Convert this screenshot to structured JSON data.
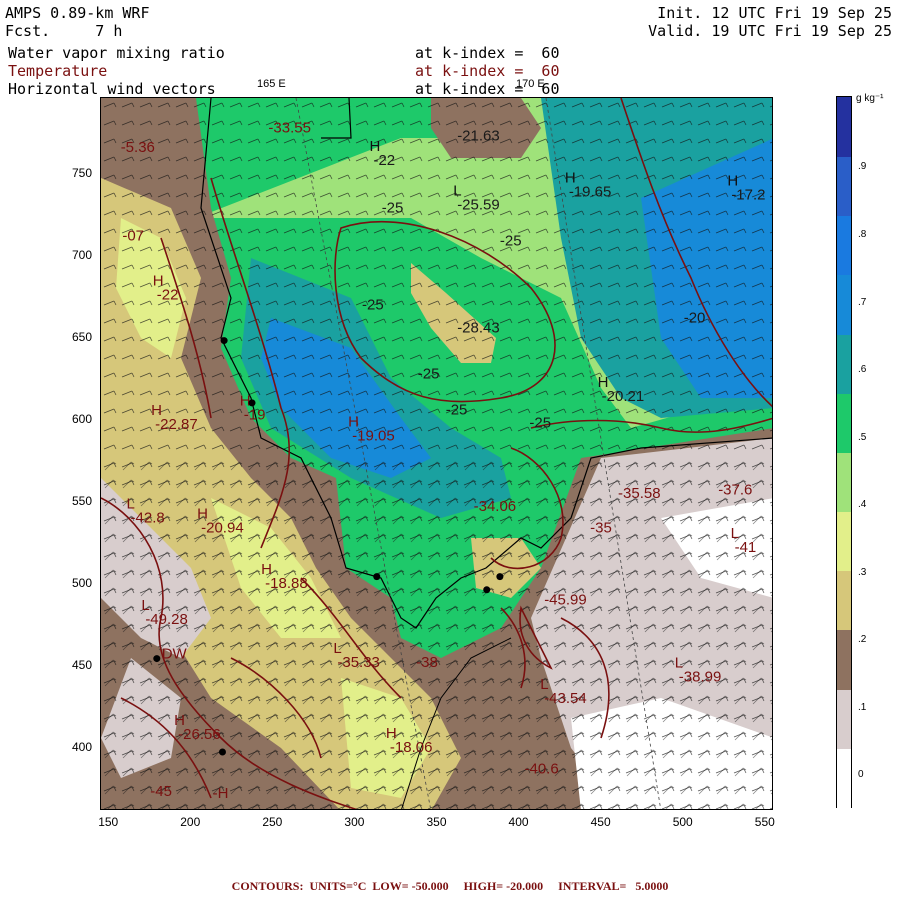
{
  "header": {
    "model": "AMPS 0.89-km WRF",
    "forecast": "Fcst.     7 h",
    "init": "Init. 12 UTC Fri 19 Sep 25",
    "valid": "Valid. 19 UTC Fri 19 Sep 25",
    "fields": [
      {
        "name": "Water vapor mixing ratio",
        "level": "at k-index =  60"
      },
      {
        "name": "Temperature",
        "level": "at k-index =  60"
      },
      {
        "name": "Horizontal wind vectors",
        "level": "at k-index =  60"
      }
    ]
  },
  "map": {
    "longitude_labels": [
      "165 E",
      "170 E"
    ],
    "x_ticks": [
      "150",
      "200",
      "250",
      "300",
      "350",
      "400",
      "450",
      "500",
      "550"
    ],
    "y_ticks": [
      "750",
      "700",
      "650",
      "600",
      "550",
      "500",
      "450",
      "400"
    ],
    "x_range": [
      145,
      555
    ],
    "y_range": [
      362,
      797
    ],
    "temperature_labels": [
      {
        "text": "-33.55",
        "x": 247,
        "y": 776,
        "type": ""
      },
      {
        "text": "-22",
        "x": 311,
        "y": 756,
        "type": "H"
      },
      {
        "text": "-21.63",
        "x": 362,
        "y": 771,
        "type": ""
      },
      {
        "text": "-25.59",
        "x": 362,
        "y": 729,
        "type": "L"
      },
      {
        "text": "-25",
        "x": 316,
        "y": 727,
        "type": ""
      },
      {
        "text": "-25",
        "x": 388,
        "y": 707,
        "type": ""
      },
      {
        "text": "-19.65",
        "x": 430,
        "y": 737,
        "type": "H"
      },
      {
        "text": "-17.2",
        "x": 529,
        "y": 735,
        "type": "H"
      },
      {
        "text": "-25",
        "x": 304,
        "y": 668,
        "type": ""
      },
      {
        "text": "-28.43",
        "x": 362,
        "y": 654,
        "type": ""
      },
      {
        "text": "-20",
        "x": 500,
        "y": 660,
        "type": ""
      },
      {
        "text": "-25",
        "x": 338,
        "y": 626,
        "type": ""
      },
      {
        "text": "-25",
        "x": 355,
        "y": 604,
        "type": ""
      },
      {
        "text": "-20.21",
        "x": 450,
        "y": 612,
        "type": "H"
      },
      {
        "text": "-19.05",
        "x": 298,
        "y": 588,
        "type": "H"
      },
      {
        "text": "-19",
        "x": 232,
        "y": 601,
        "type": "H"
      },
      {
        "text": "-25",
        "x": 406,
        "y": 596,
        "type": ""
      },
      {
        "text": "-35.58",
        "x": 460,
        "y": 553,
        "type": ""
      },
      {
        "text": "-37.6",
        "x": 521,
        "y": 555,
        "type": ""
      },
      {
        "text": "-34.06",
        "x": 372,
        "y": 545,
        "type": ""
      },
      {
        "text": "-35",
        "x": 443,
        "y": 532,
        "type": ""
      },
      {
        "text": "-41",
        "x": 531,
        "y": 520,
        "type": "L"
      },
      {
        "text": "-45.99",
        "x": 415,
        "y": 488,
        "type": ""
      },
      {
        "text": "-38.99",
        "x": 497,
        "y": 441,
        "type": "L"
      },
      {
        "text": "-43.54",
        "x": 415,
        "y": 428,
        "type": "L"
      },
      {
        "text": "-40.6",
        "x": 403,
        "y": 385,
        "type": ""
      },
      {
        "text": "-22.87",
        "x": 178,
        "y": 595,
        "type": "H"
      },
      {
        "text": "-20.94",
        "x": 206,
        "y": 532,
        "type": "H"
      },
      {
        "text": "-18.88",
        "x": 245,
        "y": 498,
        "type": "H"
      },
      {
        "text": "-42.8",
        "x": 163,
        "y": 538,
        "type": "L"
      },
      {
        "text": "-49.28",
        "x": 172,
        "y": 476,
        "type": "L"
      },
      {
        "text": "-35.33",
        "x": 289,
        "y": 450,
        "type": "L"
      },
      {
        "text": "-38",
        "x": 337,
        "y": 450,
        "type": ""
      },
      {
        "text": "-26.56",
        "x": 192,
        "y": 406,
        "type": "H"
      },
      {
        "text": "-18.06",
        "x": 321,
        "y": 398,
        "type": "H"
      },
      {
        "text": "-45",
        "x": 175,
        "y": 371,
        "type": ""
      },
      {
        "text": "-22",
        "x": 179,
        "y": 674,
        "type": "H"
      },
      {
        "text": "-5.36",
        "x": 157,
        "y": 764,
        "type": ""
      },
      {
        "text": "-07",
        "x": 158,
        "y": 710,
        "type": ""
      },
      {
        "text": "DW",
        "x": 182,
        "y": 455,
        "type": ""
      },
      {
        "text": "-H",
        "x": 213,
        "y": 370,
        "type": ""
      }
    ],
    "stations": [
      {
        "x": 220,
        "y": 649
      },
      {
        "x": 237,
        "y": 611
      },
      {
        "x": 313,
        "y": 505
      },
      {
        "x": 380,
        "y": 497
      },
      {
        "x": 388,
        "y": 505
      },
      {
        "x": 179,
        "y": 455
      },
      {
        "x": 219,
        "y": 398
      }
    ]
  },
  "colorbar": {
    "unit": "g kg⁻¹",
    "labels": [
      "0",
      ".1",
      ".2",
      ".3",
      ".4",
      ".5",
      ".6",
      ".7",
      ".8",
      ".9"
    ],
    "colors": [
      "#ffffff",
      "#d8cdcd",
      "#8e7260",
      "#d6c77a",
      "#e2ef8a",
      "#9fe27a",
      "#1ec96a",
      "#1aa1a0",
      "#178ad8",
      "#1a7ae0",
      "#2a5ec8",
      "#24319f"
    ]
  },
  "footer": "CONTOURS:  UNITS=°C  LOW= -50.000     HIGH= -20.000     INTERVAL=   5.0000"
}
